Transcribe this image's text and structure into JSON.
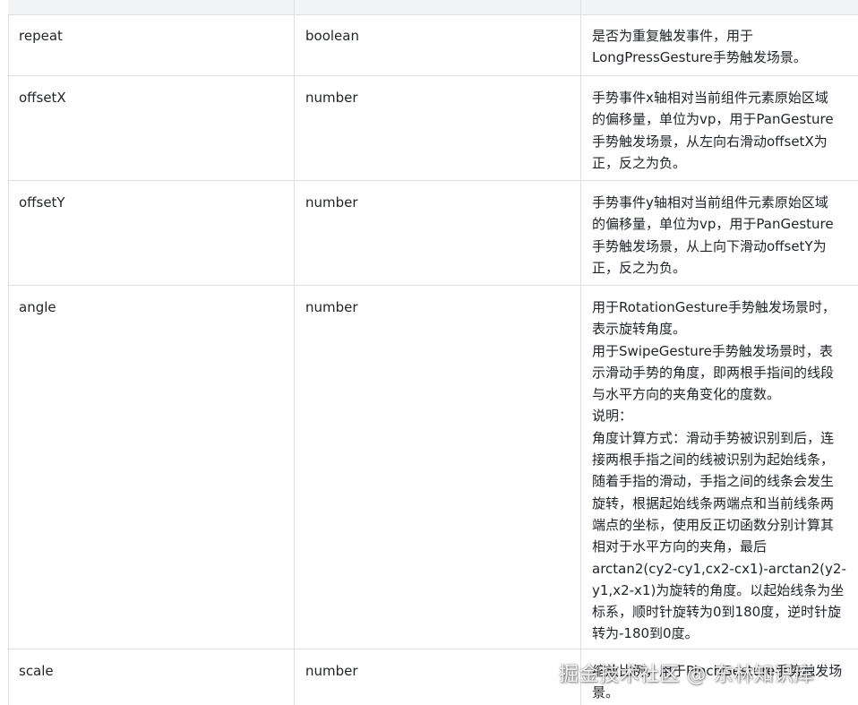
{
  "rows": [
    {
      "name": "repeat",
      "type": "boolean",
      "desc": "是否为重复触发事件，用于\nLongPressGesture手势触发场景。"
    },
    {
      "name": "offsetX",
      "type": "number",
      "desc": "手势事件x轴相对当前组件元素原始区域\n的偏移量，单位为vp，用于PanGesture\n手势触发场景，从左向右滑动offsetX为\n正，反之为负。"
    },
    {
      "name": "offsetY",
      "type": "number",
      "desc": "手势事件y轴相对当前组件元素原始区域\n的偏移量，单位为vp，用于PanGesture\n手势触发场景，从上向下滑动offsetY为\n正，反之为负。"
    },
    {
      "name": "angle",
      "type": "number",
      "desc": "用于RotationGesture手势触发场景时，\n表示旋转角度。\n用于SwipeGesture手势触发场景时，表\n示滑动手势的角度，即两根手指间的线段\n与水平方向的夹角变化的度数。\n说明：\n角度计算方式：滑动手势被识别到后，连\n接两根手指之间的线被识别为起始线条，\n随着手指的滑动，手指之间的线条会发生\n旋转，根据起始线条两端点和当前线条两\n端点的坐标，使用反正切函数分别计算其\n相对于水平方向的夹角，最后\narctan2(cy2-cy1,cx2-cx1)-arctan2(y2-\ny1,x2-x1)为旋转的角度。以起始线条为坐\n标系，顺时针旋转为0到180度，逆时针旋\n转为-180到0度。"
    },
    {
      "name": "scale",
      "type": "number",
      "desc": "缩放比例，用于PinchGesture手势触发场\n景。"
    }
  ],
  "watermark": "掘金技术社区 @ 东林知识库"
}
